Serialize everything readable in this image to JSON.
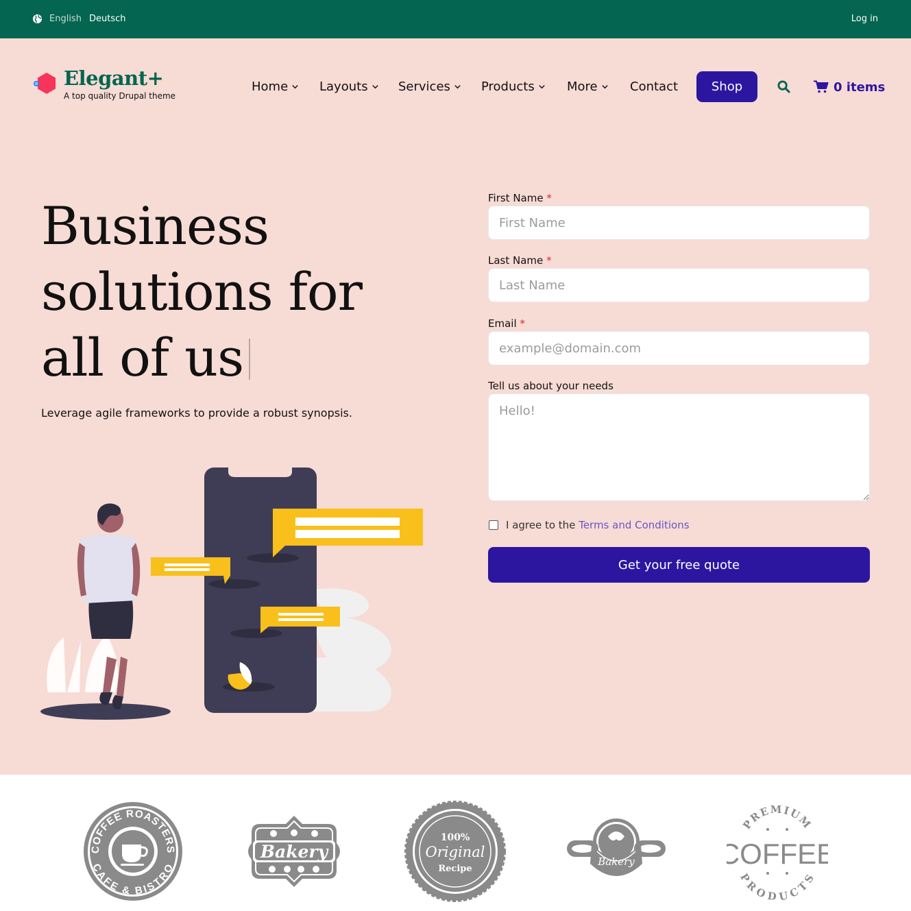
{
  "topbar": {
    "lang_english": "English",
    "lang_deutsch": "Deutsch",
    "login": "Log in"
  },
  "brand": {
    "name": "Elegant+",
    "tagline": "A top quality Drupal theme"
  },
  "nav": {
    "items": [
      {
        "label": "Home",
        "has_dropdown": true
      },
      {
        "label": "Layouts",
        "has_dropdown": true
      },
      {
        "label": "Services",
        "has_dropdown": true
      },
      {
        "label": "Products",
        "has_dropdown": true
      },
      {
        "label": "More",
        "has_dropdown": true
      },
      {
        "label": "Contact",
        "has_dropdown": false
      }
    ],
    "shop_label": "Shop",
    "cart_label": "0 items"
  },
  "hero": {
    "headline_line1": "Business",
    "headline_line2": "solutions for",
    "headline_line3": "all of us",
    "subtitle": "Leverage agile frameworks to provide a robust synopsis."
  },
  "form": {
    "first_name_label": "First Name",
    "first_name_placeholder": "First Name",
    "last_name_label": "Last Name",
    "last_name_placeholder": "Last Name",
    "email_label": "Email",
    "email_placeholder": "example@domain.com",
    "needs_label": "Tell us about your needs",
    "needs_placeholder": "Hello!",
    "required_mark": "*",
    "agree_prefix": "I agree to the",
    "agree_link": "Terms and Conditions",
    "agree_checked": false,
    "submit_label": "Get your free quote"
  },
  "logos": {
    "coffee_roasters_top": "COFFEE ROASTERS",
    "coffee_roasters_bottom": "CAFE & BISTRO",
    "bakery_1": "Bakery",
    "original_top": "100%",
    "original_mid": "Original",
    "original_bottom": "Recipe",
    "bakery_2": "Bakery",
    "premium_top": "PREMIUM",
    "premium_mid": "COFFEE",
    "premium_bottom": "PRODUCTS"
  },
  "colors": {
    "topbar_bg": "#046550",
    "hero_bg": "#f7dbd5",
    "primary": "#2c16a0",
    "accent_yellow": "#f9bf1b",
    "phone_dark": "#3f3d56"
  },
  "icons": [
    "globe-icon",
    "hexagon-logo-icon",
    "chevron-down-icon",
    "search-icon",
    "cart-icon"
  ]
}
